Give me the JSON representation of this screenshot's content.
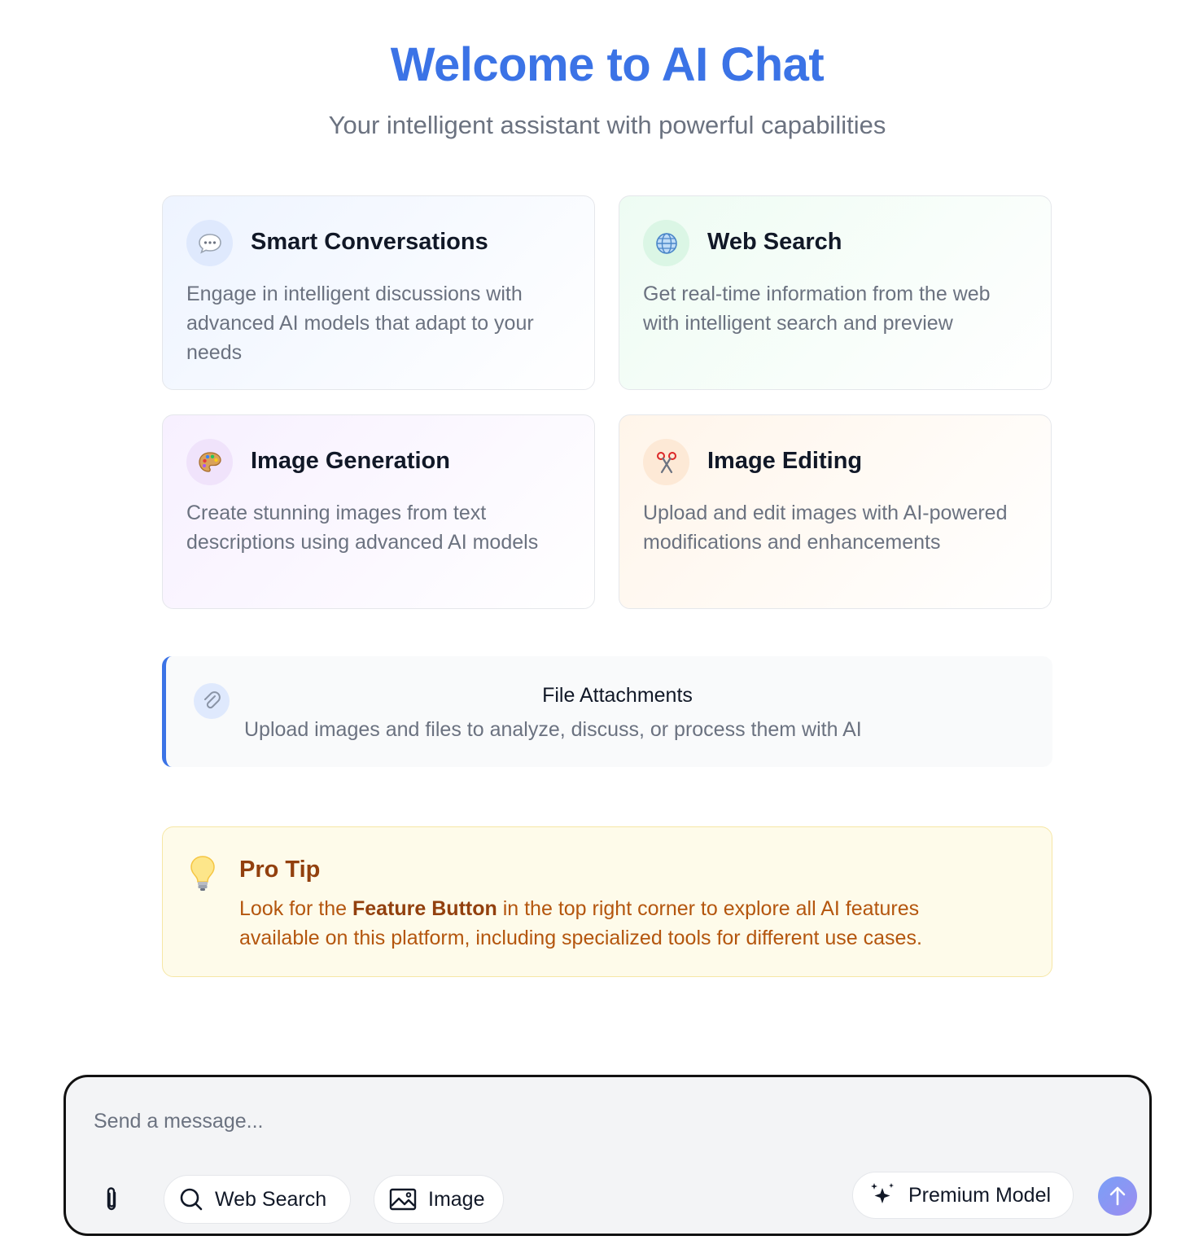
{
  "hero": {
    "title": "Welcome to AI Chat",
    "subtitle": "Your intelligent assistant with powerful capabilities"
  },
  "features": [
    {
      "icon": "speech-bubble-icon",
      "title": "Smart Conversations",
      "description": "Engage in intelligent discussions with advanced AI models that adapt to your needs"
    },
    {
      "icon": "globe-icon",
      "title": "Web Search",
      "description": "Get real-time information from the web with intelligent search and preview"
    },
    {
      "icon": "palette-icon",
      "title": "Image Generation",
      "description": "Create stunning images from text descriptions using advanced AI models"
    },
    {
      "icon": "scissors-icon",
      "title": "Image Editing",
      "description": "Upload and edit images with AI-powered modifications and enhancements"
    }
  ],
  "attachments": {
    "icon": "paperclip-icon",
    "title": "File Attachments",
    "description": "Upload images and files to analyze, discuss, or process them with AI"
  },
  "tip": {
    "icon": "lightbulb-icon",
    "title": "Pro Tip",
    "text_before": "Look for the ",
    "highlight": "Feature Button",
    "text_after": " in the top right corner to explore all AI features available on this platform, including specialized tools for different use cases."
  },
  "composer": {
    "placeholder": "Send a message...",
    "web_search_label": "Web Search",
    "image_label": "Image",
    "premium_label": "Premium Model"
  },
  "colors": {
    "accent": "#3b73e6",
    "tip_text": "#b4560e",
    "tip_title": "#92400e"
  }
}
